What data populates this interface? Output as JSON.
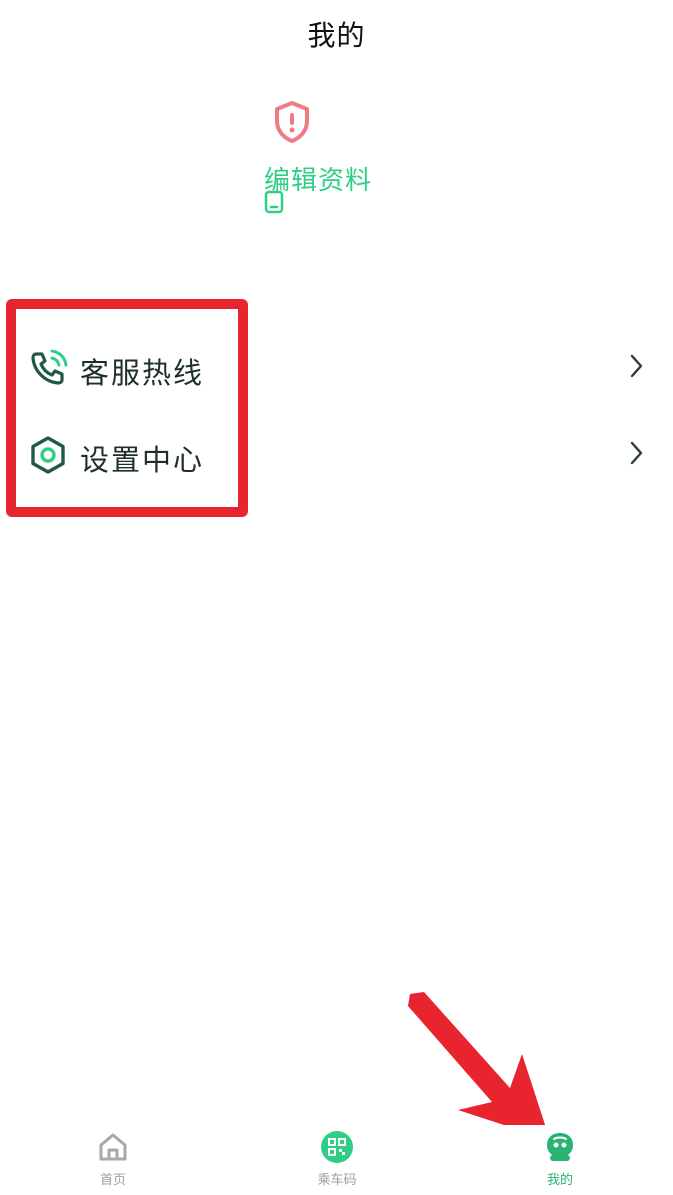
{
  "header": {
    "title": "我的"
  },
  "profile": {
    "shield_icon": "shield-alert-icon",
    "edit_label": "编辑资料",
    "edit_icon": "phone-icon"
  },
  "menu": {
    "items": [
      {
        "label": "客服热线",
        "icon": "phone-call-icon"
      },
      {
        "label": "设置中心",
        "icon": "settings-hex-icon"
      }
    ]
  },
  "tabbar": {
    "items": [
      {
        "label": "首页",
        "icon": "home-icon",
        "active": false
      },
      {
        "label": "乘车码",
        "icon": "qr-code-icon",
        "active": false
      },
      {
        "label": "我的",
        "icon": "profile-face-icon",
        "active": true
      }
    ]
  },
  "colors": {
    "accent": "#2ecf85",
    "active_tab": "#29b473",
    "shield": "#f07b85",
    "annotation": "#e8242f",
    "icon_dark": "#1f5a45"
  }
}
